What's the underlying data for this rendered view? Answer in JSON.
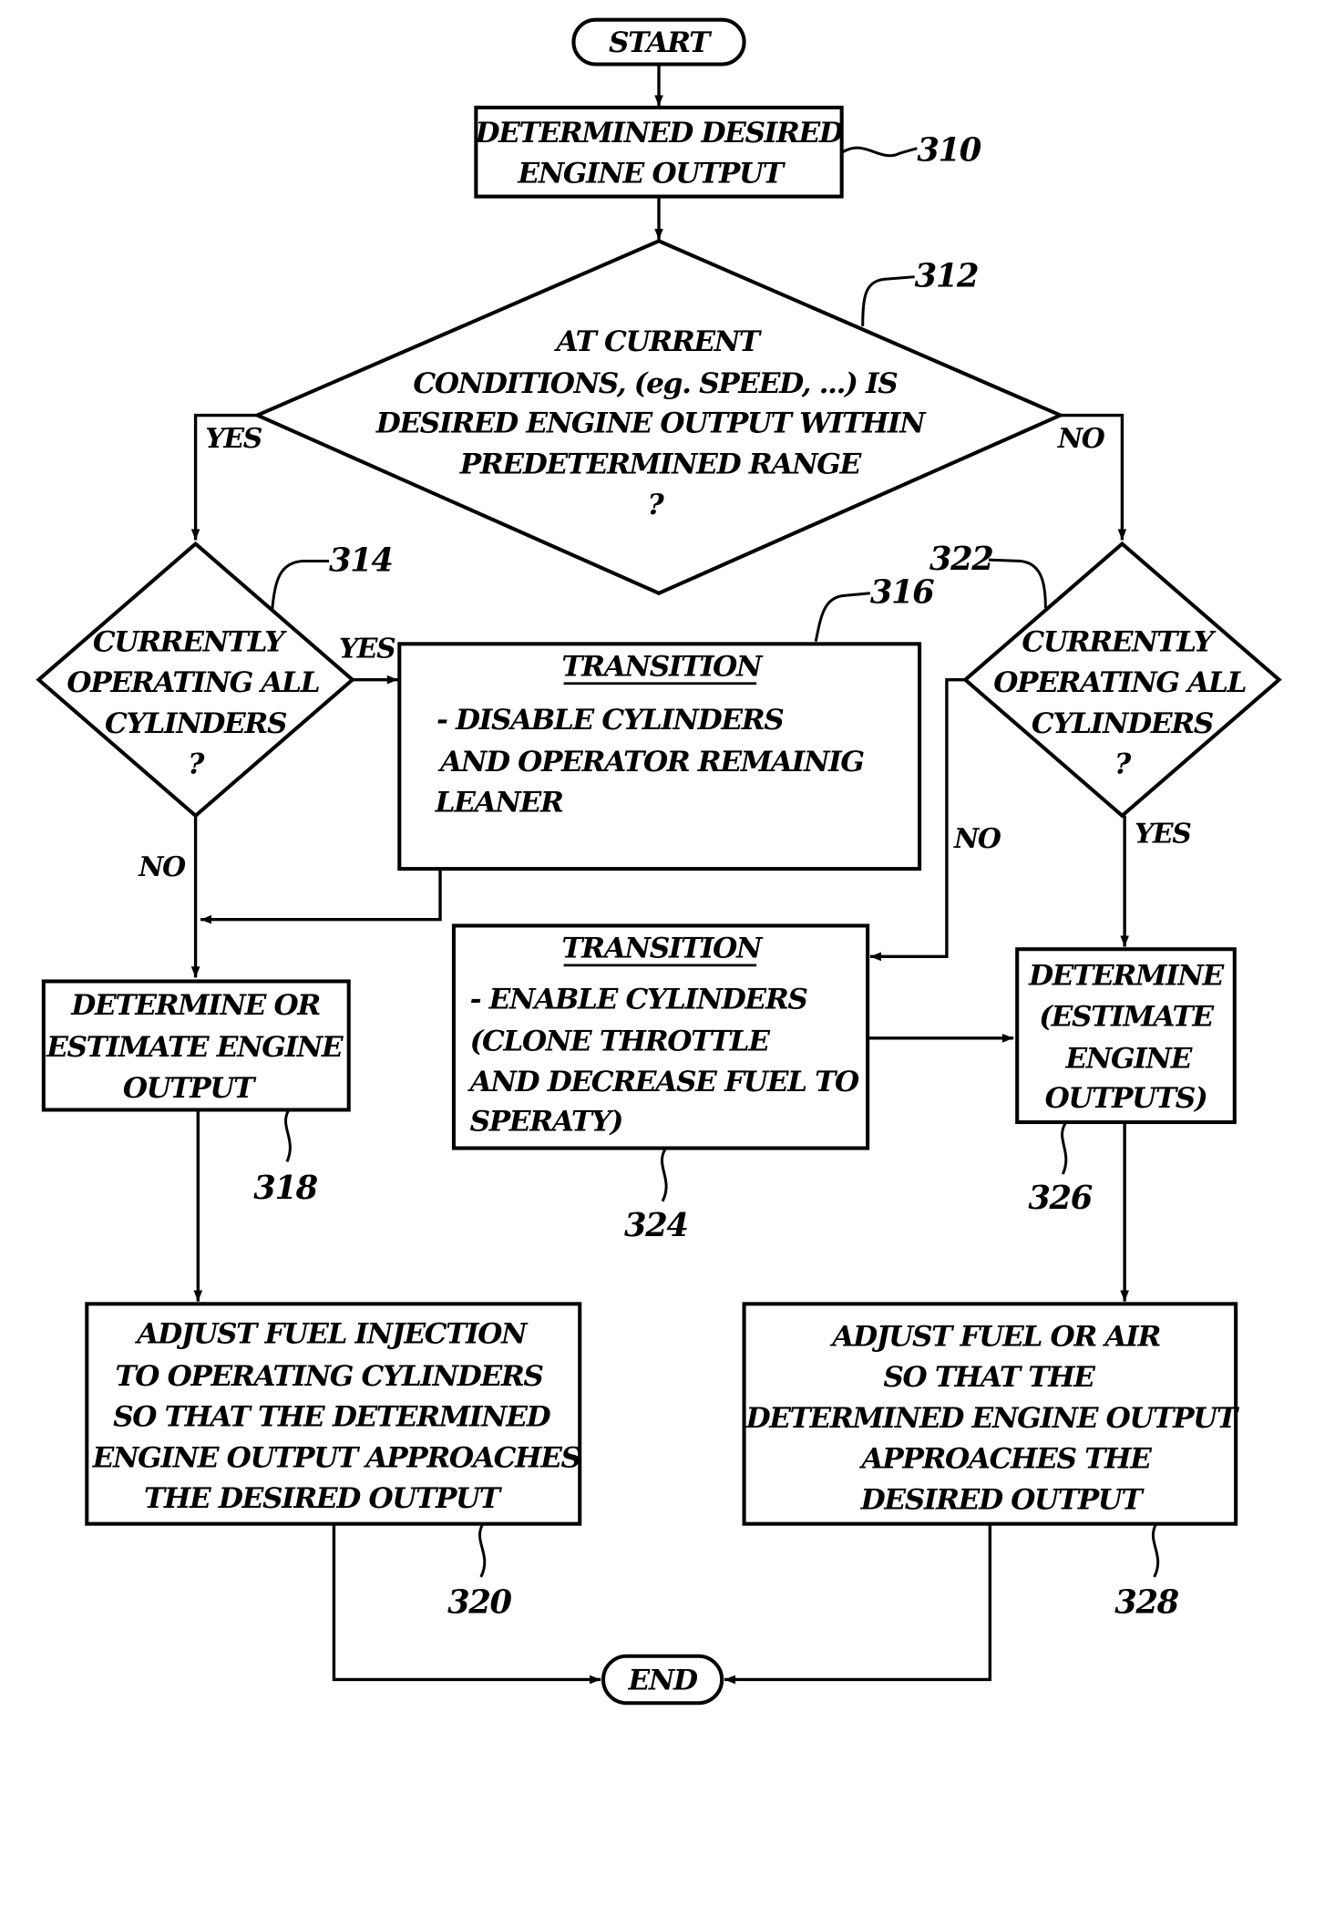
{
  "start": "START",
  "end": "END",
  "step_310": {
    "ref": "310",
    "lines": [
      "DETERMINED DESIRED",
      "ENGINE OUTPUT"
    ]
  },
  "step_312": {
    "ref": "312",
    "lines": [
      "AT CURRENT",
      "CONDITIONS, (eg. SPEED, ...) IS",
      "DESIRED ENGINE OUTPUT WITHIN",
      "PREDETERMINED RANGE",
      "?"
    ],
    "yes": "YES",
    "no": "NO"
  },
  "step_314": {
    "ref": "314",
    "lines": [
      "CURRENTLY",
      "OPERATING ALL",
      "CYLINDERS",
      "?"
    ],
    "yes": "YES",
    "no": "NO"
  },
  "step_316": {
    "ref": "316",
    "title": "TRANSITION",
    "lines": [
      "- DISABLE CYLINDERS",
      "AND OPERATOR REMAINIG",
      "LEANER"
    ]
  },
  "step_318": {
    "ref": "318",
    "lines": [
      "DETERMINE OR",
      "ESTIMATE ENGINE",
      "OUTPUT"
    ]
  },
  "step_320": {
    "ref": "320",
    "lines": [
      "ADJUST FUEL INJECTION",
      "TO OPERATING CYLINDERS",
      "SO THAT THE DETERMINED",
      "ENGINE OUTPUT APPROACHES",
      "THE DESIRED OUTPUT"
    ]
  },
  "step_322": {
    "ref": "322",
    "lines": [
      "CURRENTLY",
      "OPERATING ALL",
      "CYLINDERS",
      "?"
    ],
    "yes": "YES",
    "no": "NO"
  },
  "step_324": {
    "ref": "324",
    "title": "TRANSITION",
    "lines": [
      "- ENABLE CYLINDERS",
      "(CLONE THROTTLE",
      "AND DECREASE FUEL TO",
      "SPERATY)"
    ]
  },
  "step_326": {
    "ref": "326",
    "lines": [
      "DETERMINE",
      "(ESTIMATE",
      "ENGINE",
      "OUTPUTS)"
    ]
  },
  "step_328": {
    "ref": "328",
    "lines": [
      "ADJUST FUEL OR AIR",
      "SO THAT THE",
      "DETERMINED ENGINE OUTPUT",
      "APPROACHES THE",
      "DESIRED OUTPUT"
    ]
  }
}
